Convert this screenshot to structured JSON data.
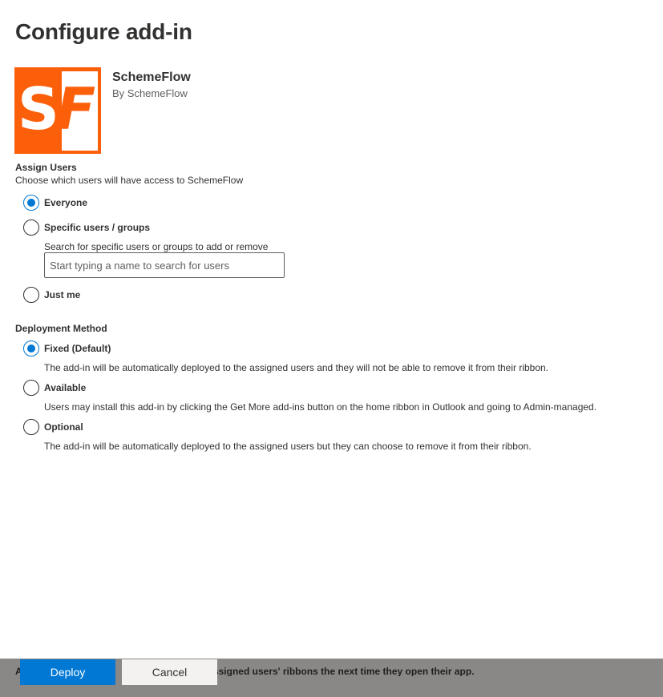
{
  "page": {
    "title": "Configure add-in"
  },
  "app": {
    "name": "SchemeFlow",
    "publisher": "By SchemeFlow",
    "logo": {
      "letters": [
        "S",
        "F"
      ],
      "brand_color": "#fc5f0a"
    }
  },
  "assign_users": {
    "title": "Assign Users",
    "description": "Choose which users will have access to SchemeFlow",
    "options": {
      "everyone": {
        "label": "Everyone",
        "selected": true
      },
      "specific": {
        "label": "Specific users / groups",
        "selected": false
      },
      "just_me": {
        "label": "Just me",
        "selected": false
      }
    },
    "search": {
      "hint": "Search for specific users or groups to add or remove",
      "placeholder": "Start typing a name to search for users",
      "value": ""
    }
  },
  "deployment": {
    "title": "Deployment Method",
    "options": {
      "fixed": {
        "label": "Fixed (Default)",
        "selected": true,
        "description": "The add-in will be automatically deployed to the assigned users and they will not be able to remove it from their ribbon."
      },
      "available": {
        "label": "Available",
        "selected": false,
        "description": "Users may install this add-in by clicking the Get More add-ins button on the home ribbon in Outlook and going to Admin-managed."
      },
      "optional": {
        "label": "Optional",
        "selected": false,
        "description": "The add-in will be automatically deployed to the assigned users but they can choose to remove it from their ribbon."
      }
    }
  },
  "footer": {
    "note": "A                    le                         available on assigned users' ribbons the next time they open their app.",
    "deploy_label": "Deploy",
    "cancel_label": "Cancel"
  },
  "colors": {
    "accent": "#0078d4",
    "text": "#323130",
    "footer_bg": "#8a8886"
  }
}
